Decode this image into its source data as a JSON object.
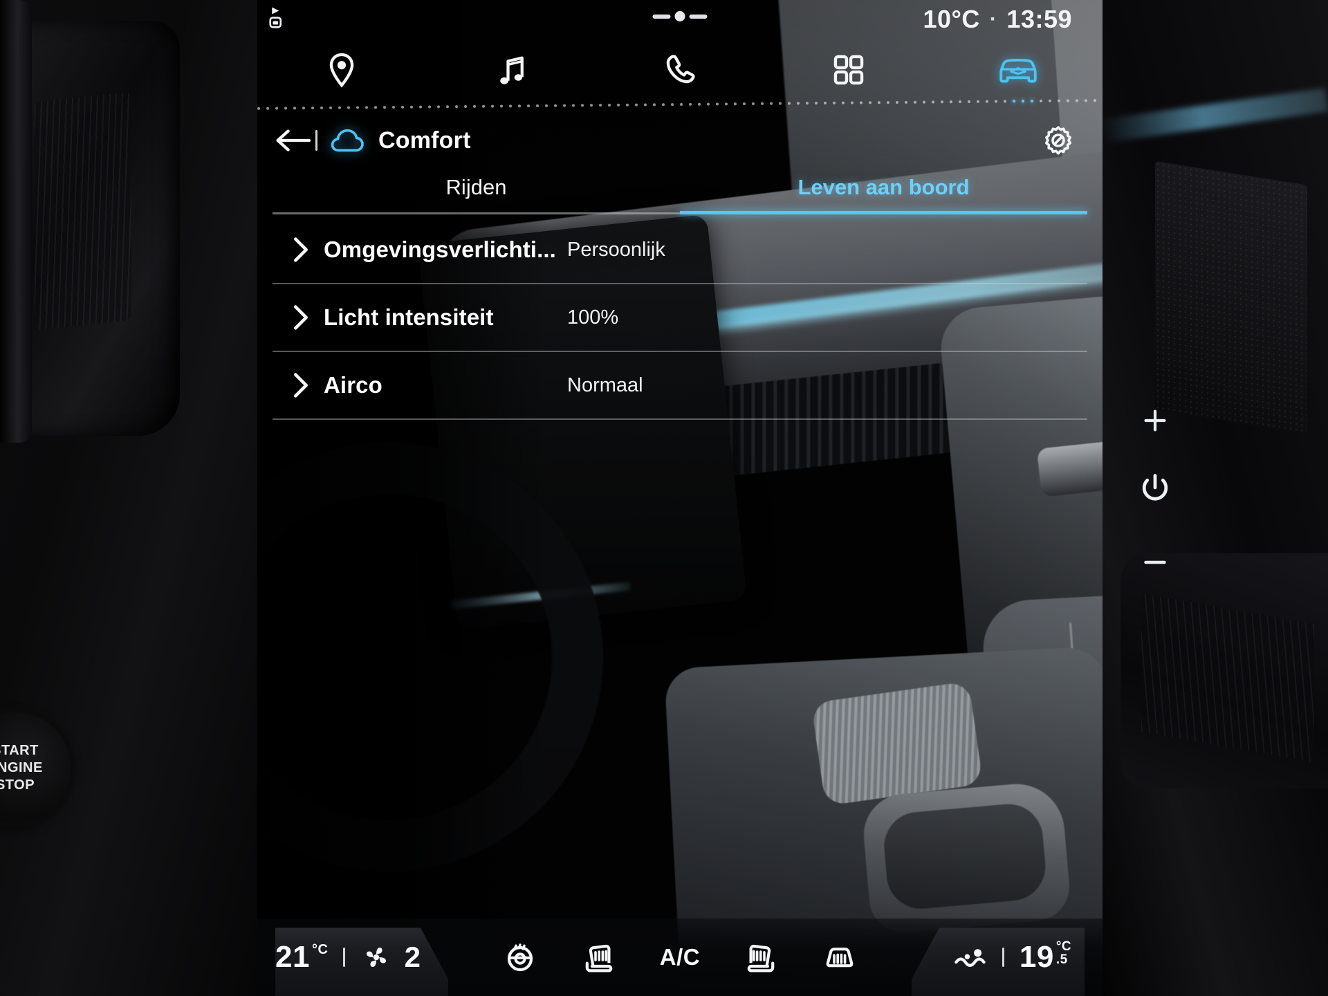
{
  "statusbar": {
    "nav_indicator_icon": "navigation-car-icon",
    "temperature": "10°C",
    "separator": "·",
    "time": "13:59"
  },
  "mainnav": {
    "items": [
      {
        "name": "navigation",
        "icon": "location-pin-icon",
        "active": false
      },
      {
        "name": "media",
        "icon": "music-note-icon",
        "active": false
      },
      {
        "name": "phone",
        "icon": "phone-handset-icon",
        "active": false
      },
      {
        "name": "apps",
        "icon": "apps-grid-icon",
        "active": false
      },
      {
        "name": "vehicle",
        "icon": "car-front-icon",
        "active": true
      }
    ]
  },
  "header": {
    "back_label": "back-arrow",
    "brand_icon": "cloud-icon",
    "title": "Comfort",
    "settings_icon": "gear-icon"
  },
  "tabs": [
    {
      "label": "Rijden",
      "active": false
    },
    {
      "label": "Leven aan boord",
      "active": true
    }
  ],
  "settings_rows": [
    {
      "label": "Omgevingsverlichti...",
      "value": "Persoonlijk"
    },
    {
      "label": "Licht intensiteit",
      "value": "100%"
    },
    {
      "label": "Airco",
      "value": "Normaal"
    }
  ],
  "climate": {
    "left": {
      "temperature": "21",
      "unit": "°C",
      "fan_icon": "fan-icon",
      "fan_level": "2"
    },
    "center_icons": [
      {
        "name": "steering-wheel-heater-icon",
        "label": ""
      },
      {
        "name": "seat-heater-left-icon",
        "label": ""
      },
      {
        "name": "ac-toggle",
        "label": "A/C"
      },
      {
        "name": "seat-heater-right-icon",
        "label": ""
      },
      {
        "name": "rear-defrost-icon",
        "label": ""
      }
    ],
    "right": {
      "airflow_icon": "airflow-icon",
      "temperature": "19",
      "unit": "°C",
      "decimal": ".5"
    }
  },
  "bezel": {
    "volume_up": "+",
    "power_icon": "power-icon",
    "volume_down": "−"
  },
  "dashboard": {
    "start_button_lines": [
      "START",
      "ENGINE",
      "STOP"
    ]
  },
  "colors": {
    "accent": "#58c6f3",
    "text_primary": "#ffffff",
    "text_secondary": "#f0f2f4",
    "screen_bg": "#000000"
  }
}
